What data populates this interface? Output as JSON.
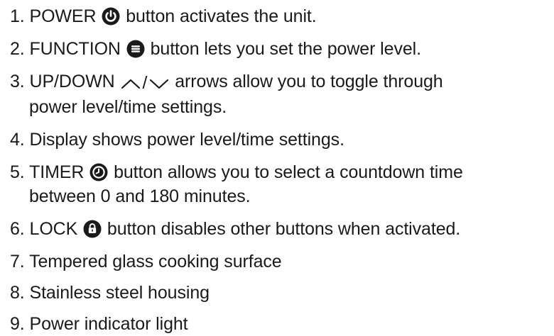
{
  "items": [
    {
      "num": "1.",
      "pre": "POWER",
      "icon": "power-icon",
      "post": "button activates the unit."
    },
    {
      "num": "2.",
      "pre": "FUNCTION",
      "icon": "menu-icon",
      "post": "button lets you set the power level."
    },
    {
      "num": "3.",
      "pre": "UP/DOWN",
      "icon": "up-down-arrows-icon",
      "post": "arrows allow you to toggle through",
      "cont": "power level/time settings."
    },
    {
      "num": "4.",
      "text": "Display shows power level/time settings."
    },
    {
      "num": "5.",
      "pre": "TIMER",
      "icon": "clock-icon",
      "post": "button allows you to select a countdown time",
      "cont": "between 0 and 180 minutes."
    },
    {
      "num": "6.",
      "pre": "LOCK",
      "icon": "lock-icon",
      "post": "button disables other buttons when activated."
    },
    {
      "num": "7.",
      "text": "Tempered glass cooking surface"
    },
    {
      "num": "8.",
      "text": "Stainless steel housing"
    },
    {
      "num": "9.",
      "text": "Power indicator light"
    }
  ]
}
